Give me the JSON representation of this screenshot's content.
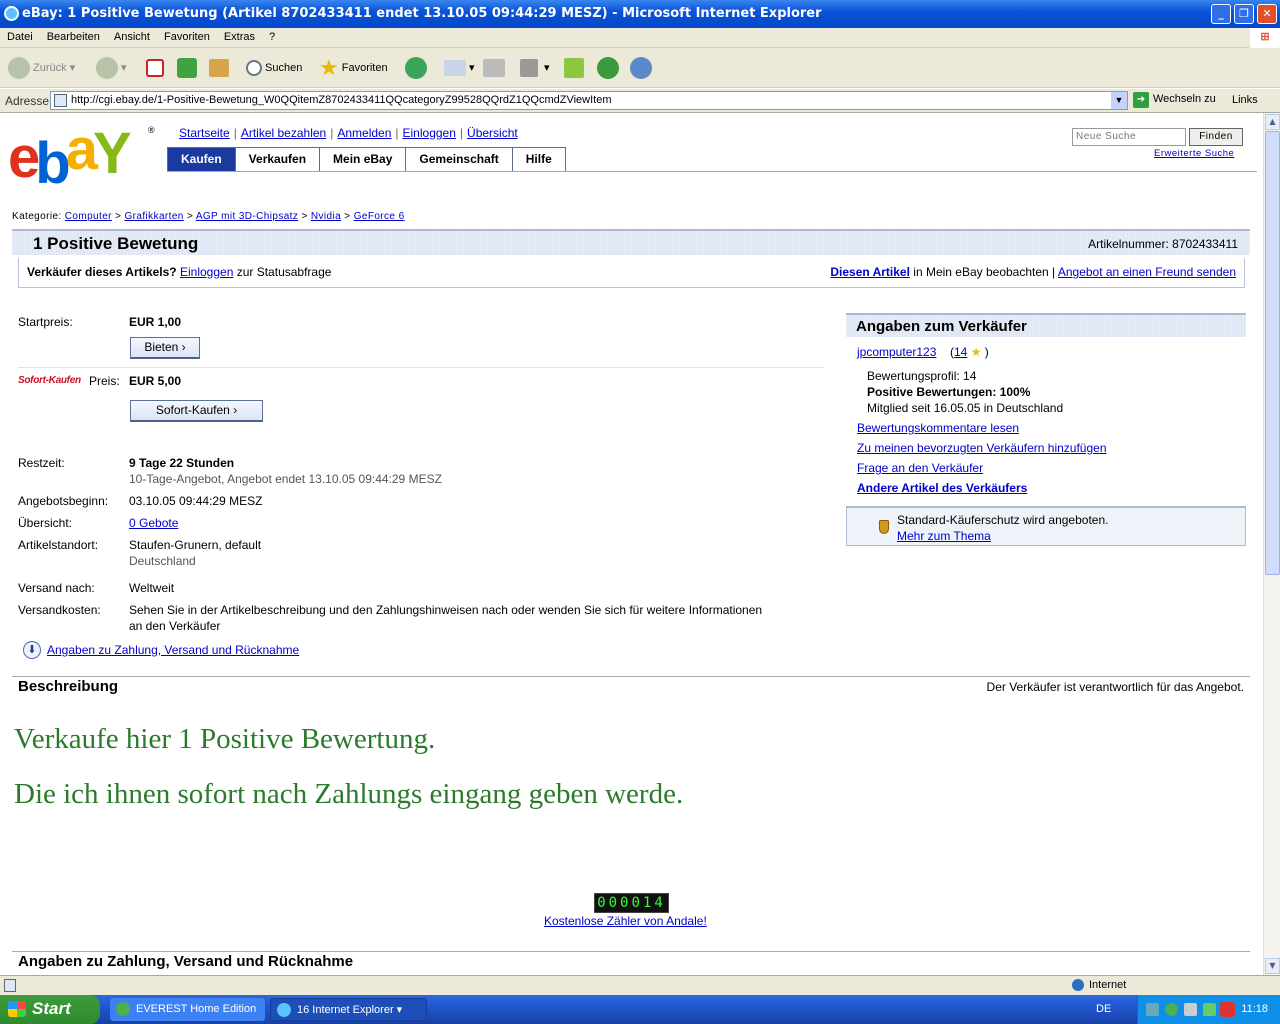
{
  "window": {
    "title": "eBay: 1 Positive Bewetung (Artikel 8702433411 endet 13.10.05 09:44:29 MESZ) - Microsoft Internet Explorer"
  },
  "menu": [
    "Datei",
    "Bearbeiten",
    "Ansicht",
    "Favoriten",
    "Extras",
    "?"
  ],
  "toolbar": {
    "back": "Zurück",
    "search": "Suchen",
    "favorites": "Favoriten"
  },
  "address": {
    "label": "Adresse",
    "url": "http://cgi.ebay.de/1-Positive-Bewetung_W0QQitemZ8702433411QQcategoryZ99528QQrdZ1QQcmdZViewItem",
    "go": "Wechseln zu",
    "links": "Links"
  },
  "header": {
    "toplinks": [
      "Startseite",
      "Artikel bezahlen",
      "Anmelden",
      "Einloggen",
      "Übersicht"
    ],
    "tabs": [
      "Kaufen",
      "Verkaufen",
      "Mein eBay",
      "Gemeinschaft",
      "Hilfe"
    ],
    "search_placeholder": "Neue Suche",
    "find": "Finden",
    "advanced": "Erweiterte Suche"
  },
  "breadcrumb": {
    "label": "Kategorie:",
    "items": [
      "Computer",
      "Grafikkarten",
      "AGP mit 3D-Chipsatz",
      "Nvidia",
      "GeForce 6"
    ]
  },
  "item": {
    "title": "1 Positive Bewetung",
    "number": "Artikelnummer: 8702433411",
    "seller_q": "Verkäufer dieses Artikels?",
    "login": "Einloggen",
    "status": "zur Statusabfrage",
    "watch": "Diesen Artikel",
    "watch_suffix": "in Mein eBay beobachten |",
    "send_friend": "Angebot an einen Freund senden",
    "start_label": "Startpreis:",
    "start_price": "EUR 1,00",
    "bid_button": "Bieten ›",
    "sofort_logo": "Sofort-Kaufen",
    "buy_label": "Preis:",
    "buy_price": "EUR 5,00",
    "buy_button": "Sofort-Kaufen ›",
    "rest_label": "Restzeit:",
    "rest_value": "9 Tage 22 Stunden",
    "rest_sub": "10-Tage-Angebot, Angebot endet 13.10.05 09:44:29 MESZ",
    "begin_label": "Angebotsbeginn:",
    "begin_value": "03.10.05 09:44:29 MESZ",
    "overview_label": "Übersicht:",
    "overview_value": "0 Gebote",
    "location_label": "Artikelstandort:",
    "location_value": "Staufen-Grunern, default",
    "location_country": "Deutschland",
    "ship_label": "Versand nach:",
    "ship_value": "Weltweit",
    "cost_label": "Versandkosten:",
    "cost_value1": "Sehen Sie in der Artikelbeschreibung und den Zahlungshinweisen nach oder wenden Sie sich für weitere Informationen",
    "cost_value2": "an den Verkäufer",
    "payment_link": "Angaben zu Zahlung, Versand und Rücknahme"
  },
  "seller": {
    "heading": "Angaben zum Verkäufer",
    "name": "jpcomputer123",
    "score": "14",
    "profile": "Bewertungsprofil: 14",
    "positive": "Positive Bewertungen: 100%",
    "member": "Mitglied seit 16.05.05 in Deutschland",
    "links": [
      "Bewertungskommentare lesen",
      "Zu meinen bevorzugten Verkäufern hinzufügen",
      "Frage an den Verkäufer"
    ],
    "other": "Andere Artikel des Verkäufers",
    "protect": "Standard-Käuferschutz wird angeboten.",
    "more": "Mehr zum Thema"
  },
  "description": {
    "heading": "Beschreibung",
    "responsible": "Der Verkäufer ist verantwortlich für das Angebot.",
    "line1": "Verkaufe hier 1 Positive Bewertung.",
    "line2": "Die ich ihnen sofort nach Zahlungs eingang geben werde.",
    "counter": "000014",
    "counter_link": "Kostenlose Zähler von Andale!",
    "section2": "Angaben zu Zahlung, Versand und Rücknahme"
  },
  "status": {
    "zone": "Internet"
  },
  "taskbar": {
    "start": "Start",
    "tasks": [
      "EVEREST Home Edition",
      "16 Internet Explorer"
    ],
    "lang": "DE",
    "clock": "11:18"
  }
}
